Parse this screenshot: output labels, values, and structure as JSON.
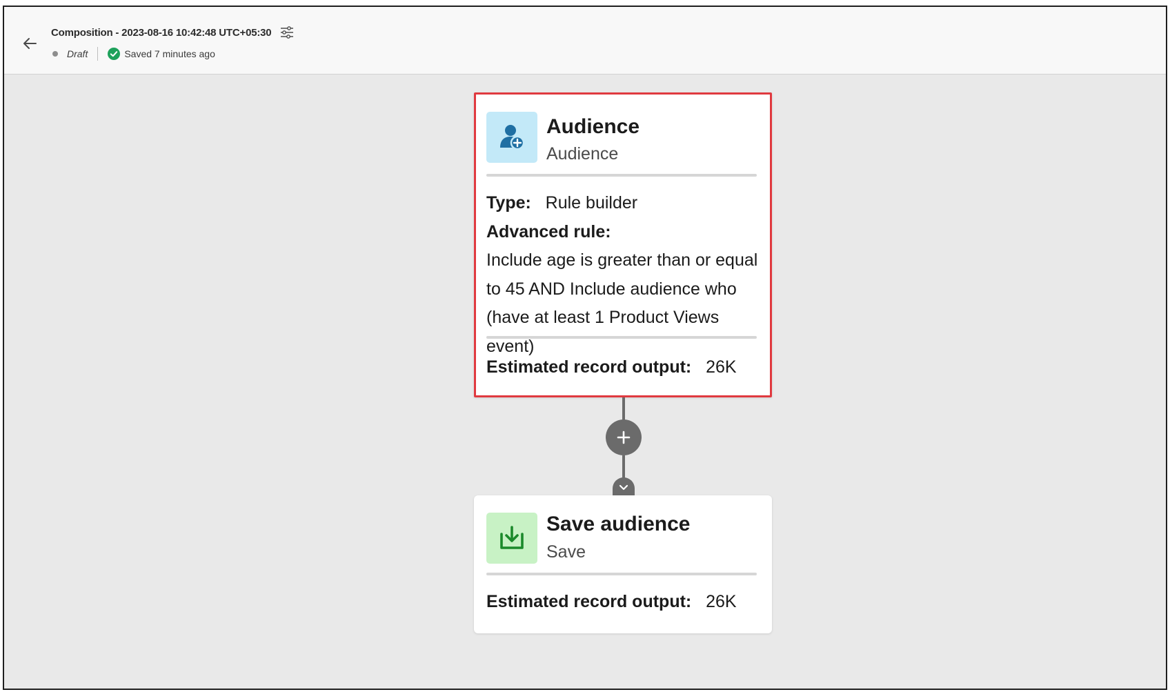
{
  "header": {
    "title": "Composition - 2023-08-16 10:42:48 UTC+05:30",
    "status": "Draft",
    "saved_text": "Saved 7 minutes ago"
  },
  "nodes": {
    "audience": {
      "title": "Audience",
      "subtitle": "Audience",
      "type_label": "Type:",
      "type_value": "Rule builder",
      "advanced_rule_label": "Advanced rule:",
      "rule_line1": "Include age is greater than or equal",
      "rule_line2": "to 45 AND Include audience who",
      "rule_line3": "(have at least 1 Product Views event)",
      "estimate_label": "Estimated record output:",
      "estimate_value": "26K"
    },
    "save": {
      "title": "Save audience",
      "subtitle": "Save",
      "estimate_label": "Estimated record output:",
      "estimate_value": "26K"
    }
  },
  "colors": {
    "selection_border": "#e0393f",
    "audience_icon_bg": "#c3e9f8",
    "audience_icon_fg": "#1f6fa3",
    "save_icon_bg": "#c8f2c5",
    "save_icon_fg": "#1b8a2b",
    "saved_check": "#1ea15b",
    "connector": "#6b6b6b"
  },
  "icons": {
    "back": "arrow-left-icon",
    "settings": "sliders-icon",
    "saved": "check-circle-icon",
    "audience": "user-add-icon",
    "save": "download-icon",
    "add": "plus-icon",
    "collapse": "chevron-down-icon"
  }
}
